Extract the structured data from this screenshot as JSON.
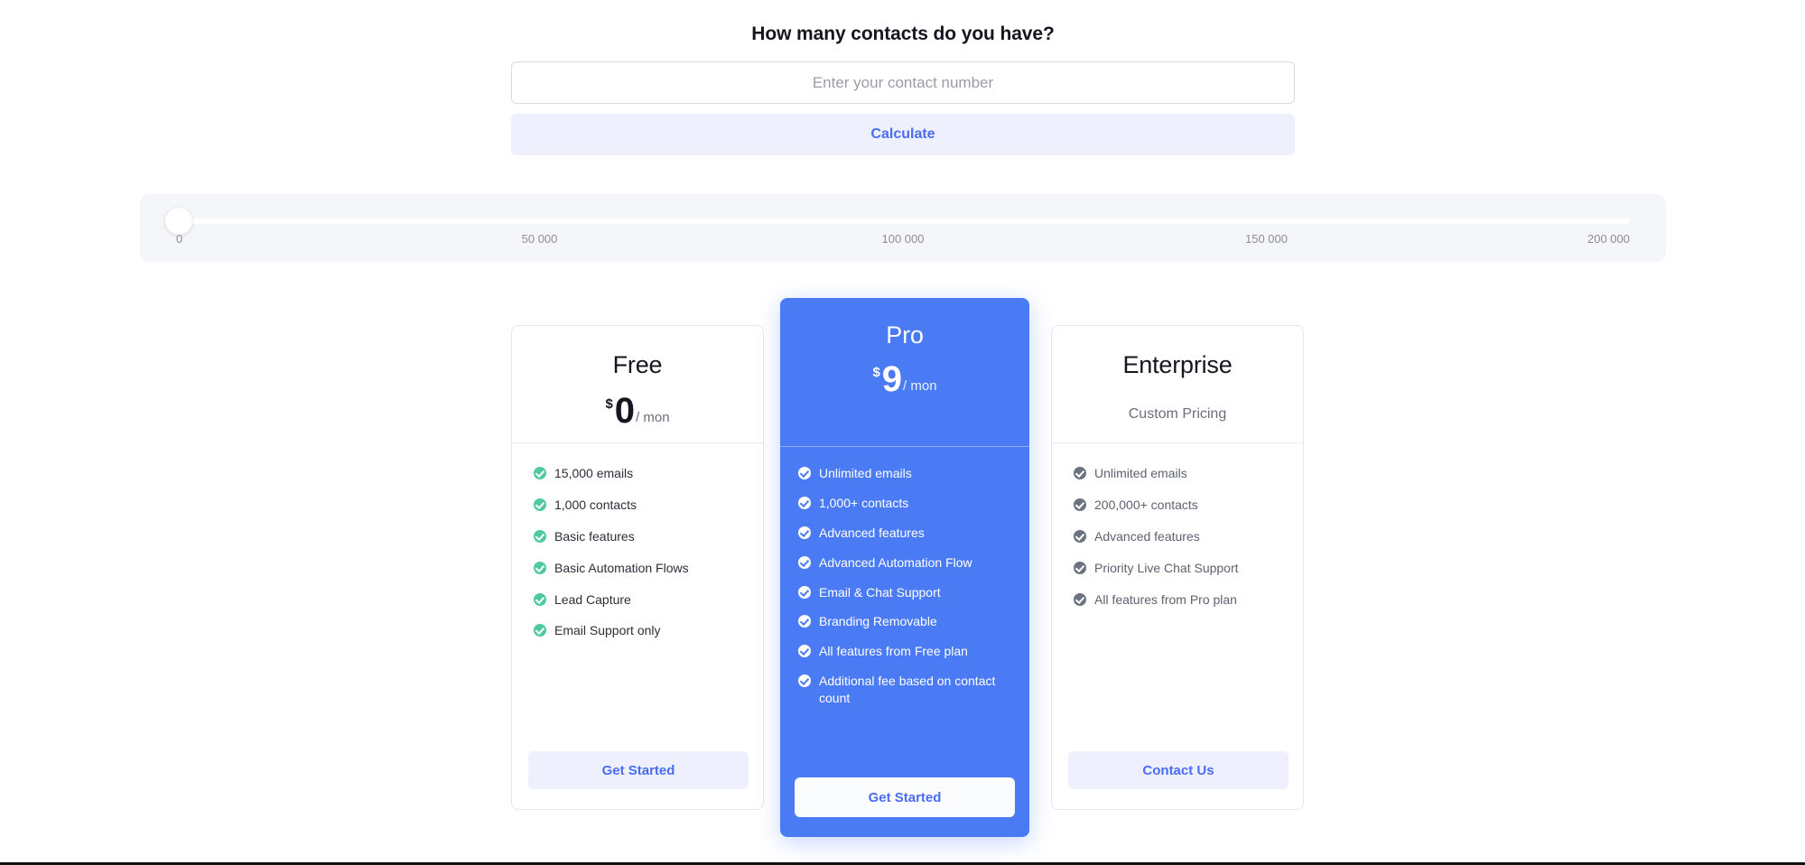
{
  "calculator": {
    "question": "How many contacts do you have?",
    "input_value": "",
    "input_placeholder": "Enter your contact number",
    "calculate_label": "Calculate"
  },
  "slider": {
    "value": 0,
    "min": 0,
    "max": 200000,
    "ticks": [
      {
        "label": "0",
        "value": 0,
        "pos_pct": 0
      },
      {
        "label": "50 000",
        "value": 50000,
        "pos_pct": 25
      },
      {
        "label": "100 000",
        "value": 100000,
        "pos_pct": 50
      },
      {
        "label": "150 000",
        "value": 150000,
        "pos_pct": 75
      },
      {
        "label": "200 000",
        "value": 200000,
        "pos_pct": 100
      }
    ]
  },
  "colors": {
    "accent_blue": "#4A7BF5",
    "button_blue_text": "#4a6cf0",
    "button_pale": "#eef1fd",
    "check_green": "#4ec9a0",
    "check_gray": "#6b7280",
    "panel_gray": "#f5f6fa"
  },
  "plans": [
    {
      "name": "Free",
      "currency": "$",
      "amount": "0",
      "period": "/ mon",
      "features": [
        "15,000 emails",
        "1,000 contacts",
        "Basic features",
        "Basic Automation Flows",
        "Lead Capture",
        "Email Support only"
      ],
      "cta": "Get Started"
    },
    {
      "name": "Pro",
      "currency": "$",
      "amount": "9",
      "period": "/ mon",
      "features": [
        "Unlimited emails",
        "1,000+ contacts",
        "Advanced features",
        "Advanced Automation Flow",
        "Email & Chat Support",
        "Branding Removable",
        "All features from Free plan",
        "Additional fee based on contact count"
      ],
      "cta": "Get Started"
    },
    {
      "name": "Enterprise",
      "pricing_text": "Custom Pricing",
      "features": [
        "Unlimited emails",
        "200,000+ contacts",
        "Advanced features",
        "Priority Live Chat Support",
        "All features from Pro plan"
      ],
      "cta": "Contact Us"
    }
  ]
}
